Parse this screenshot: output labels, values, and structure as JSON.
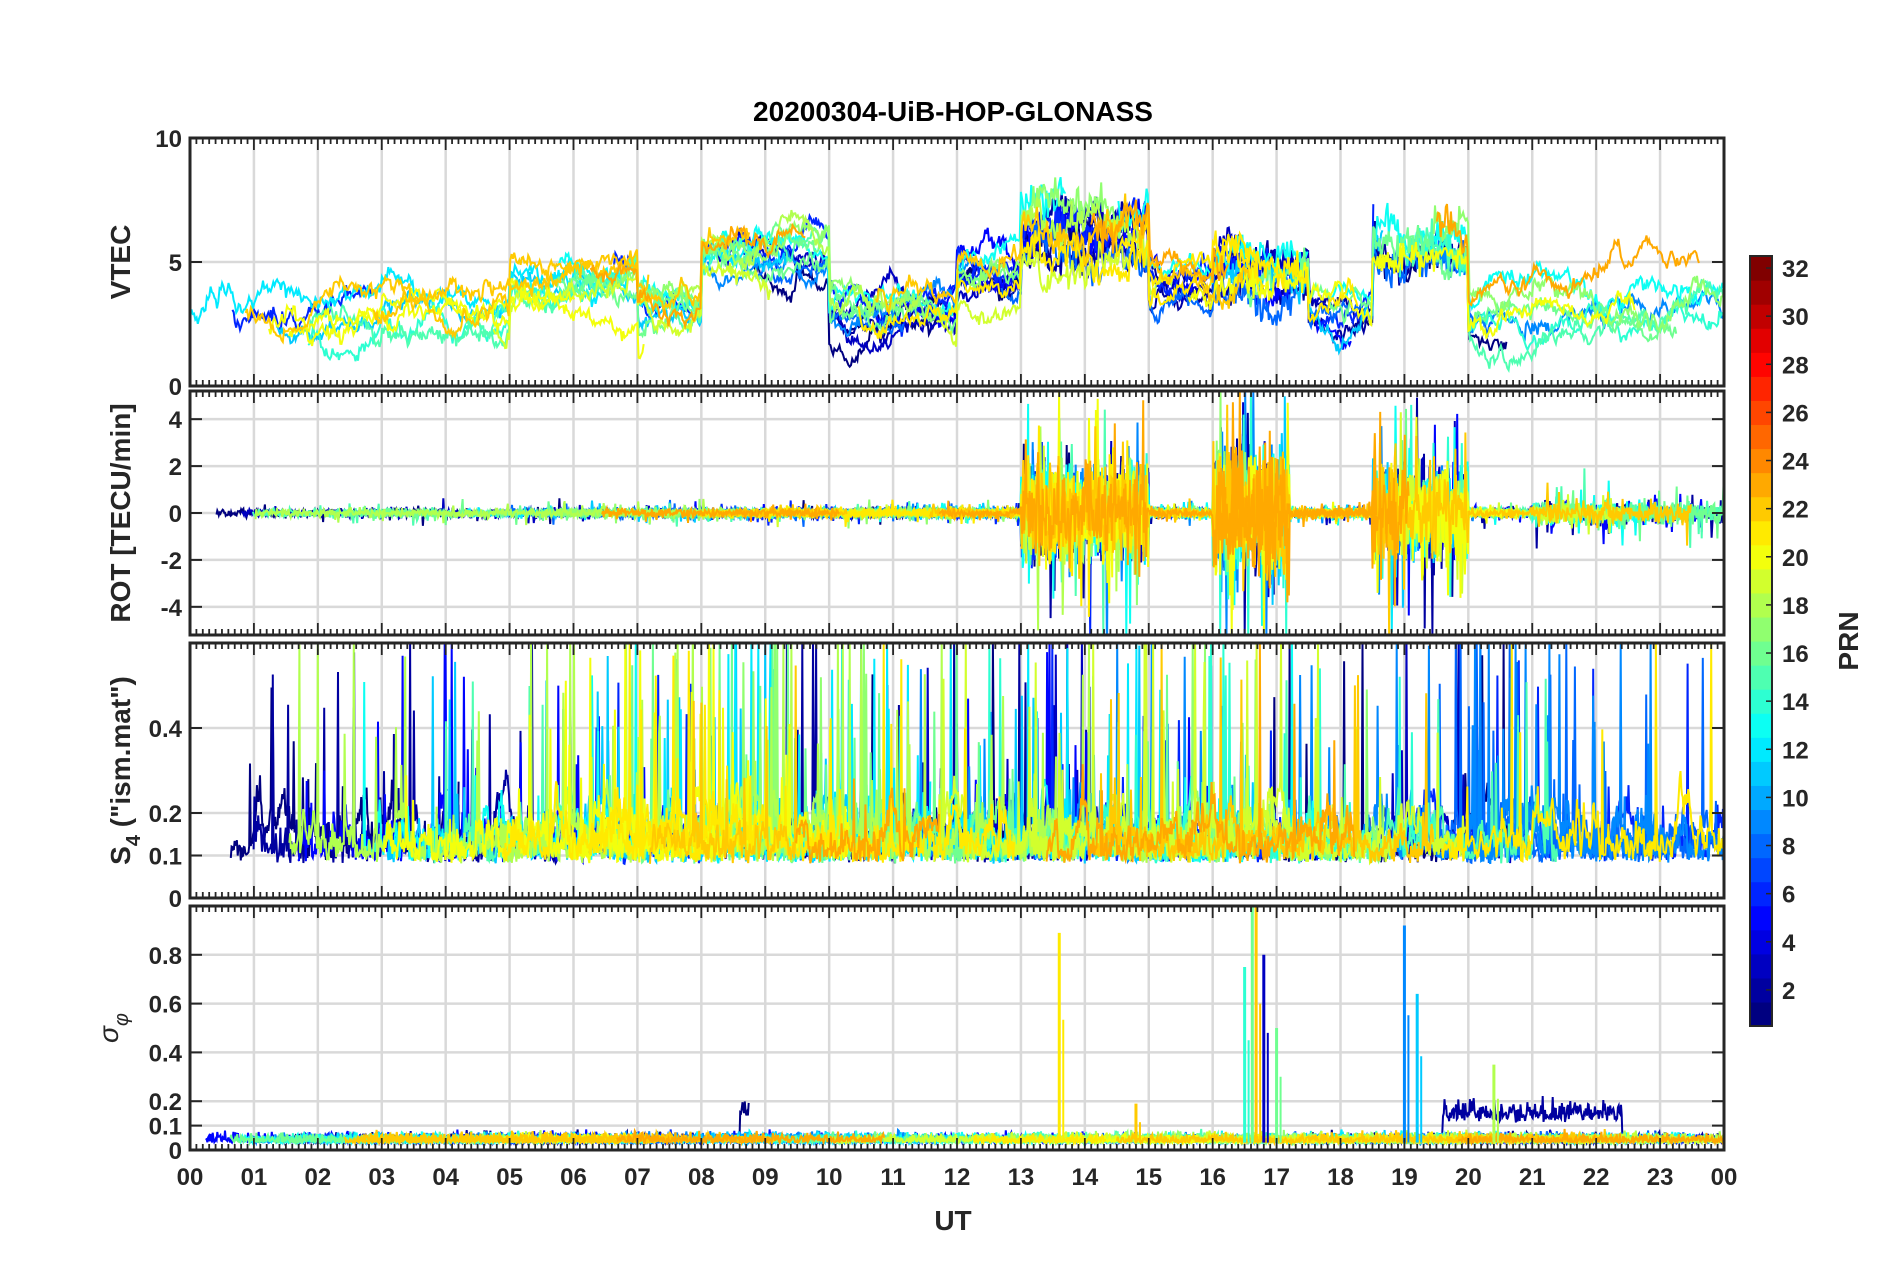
{
  "chart_data": {
    "type": "line",
    "title": "20200304-UiB-HOP-GLONASS",
    "xlabel": "UT",
    "x_tick_labels": [
      "00",
      "01",
      "02",
      "03",
      "04",
      "05",
      "06",
      "07",
      "08",
      "09",
      "10",
      "11",
      "12",
      "13",
      "14",
      "15",
      "16",
      "17",
      "18",
      "19",
      "20",
      "21",
      "22",
      "23",
      "00"
    ],
    "xlim": [
      0,
      24
    ],
    "grid": true,
    "panels": [
      {
        "name": "vtec",
        "ylabel": "VTEC",
        "ylim": [
          0,
          10
        ],
        "yticks": [
          0,
          5,
          10
        ],
        "ytick_labels": [
          "0",
          "5",
          "10"
        ],
        "baseline": 3.0,
        "activity": [
          [
            0,
            3,
            2.6
          ],
          [
            5,
            7,
            4.2
          ],
          [
            8,
            10,
            5.2
          ],
          [
            12,
            13,
            4.5
          ],
          [
            13,
            15,
            6.0
          ],
          [
            15,
            16,
            4.0
          ],
          [
            16,
            17.5,
            4.6
          ],
          [
            18.5,
            20,
            5.8
          ],
          [
            21,
            24,
            3.2
          ]
        ]
      },
      {
        "name": "rot",
        "ylabel": "ROT [TECU/min]",
        "ylim": [
          -5.2,
          5.2
        ],
        "yticks": [
          -4,
          -2,
          0,
          2,
          4
        ],
        "ytick_labels": [
          "-4",
          "-2",
          "0",
          "2",
          "4"
        ],
        "bursts": [
          [
            13.0,
            15.0,
            2.5
          ],
          [
            16.0,
            17.2,
            3.5
          ],
          [
            18.5,
            20.0,
            2.5
          ],
          [
            21,
            24,
            0.7
          ]
        ]
      },
      {
        "name": "s4",
        "ylabel": "S4 (\"ism.mat\")",
        "ylabel_main": "S",
        "ylabel_sub": "4",
        "ylabel_rest": " (\"ism.mat\")",
        "ylim": [
          0,
          0.6
        ],
        "yticks": [
          0,
          0.1,
          0.2,
          0.4
        ],
        "ytick_labels": [
          "0",
          "0.1",
          "0.2",
          "0.4"
        ],
        "baseline": 0.08,
        "peak": 0.55
      },
      {
        "name": "sigma_phi",
        "ylabel": "σ φ",
        "ylabel_main": "σ",
        "ylabel_sub": "φ",
        "ylim": [
          0,
          1.0
        ],
        "yticks": [
          0,
          0.1,
          0.2,
          0.4,
          0.6,
          0.8
        ],
        "ytick_labels": [
          "0",
          "0.1",
          "0.2",
          "0.4",
          "0.6",
          "0.8"
        ],
        "baseline": 0.03,
        "spikes": [
          {
            "x": 13.6,
            "y": 0.89,
            "prn": 21
          },
          {
            "x": 14.8,
            "y": 0.19,
            "prn": 22
          },
          {
            "x": 16.5,
            "y": 0.75,
            "prn": 14
          },
          {
            "x": 16.62,
            "y": 1.0,
            "prn": 16
          },
          {
            "x": 16.68,
            "y": 1.0,
            "prn": 22
          },
          {
            "x": 16.8,
            "y": 0.8,
            "prn": 3
          },
          {
            "x": 17.0,
            "y": 0.5,
            "prn": 16
          },
          {
            "x": 19.0,
            "y": 0.92,
            "prn": 9
          },
          {
            "x": 19.2,
            "y": 0.64,
            "prn": 11
          },
          {
            "x": 20.4,
            "y": 0.35,
            "prn": 18
          }
        ],
        "elevated": [
          [
            8.6,
            11.2,
            0.2,
            1
          ],
          [
            19.6,
            22.4,
            0.17,
            2
          ]
        ]
      }
    ],
    "series_prn": [
      1,
      2,
      3,
      5,
      6,
      8,
      9,
      11,
      12,
      13,
      14,
      15,
      16,
      17,
      18,
      19,
      20,
      21,
      22,
      23
    ],
    "colorbar": {
      "label": "PRN",
      "min": 1,
      "max": 32,
      "ticks": [
        2,
        4,
        6,
        8,
        10,
        12,
        14,
        16,
        18,
        20,
        22,
        24,
        26,
        28,
        30,
        32
      ],
      "tick_labels": [
        "2",
        "4",
        "6",
        "8",
        "10",
        "12",
        "14",
        "16",
        "18",
        "20",
        "22",
        "24",
        "26",
        "28",
        "30",
        "32"
      ],
      "colormap": "jet"
    }
  }
}
